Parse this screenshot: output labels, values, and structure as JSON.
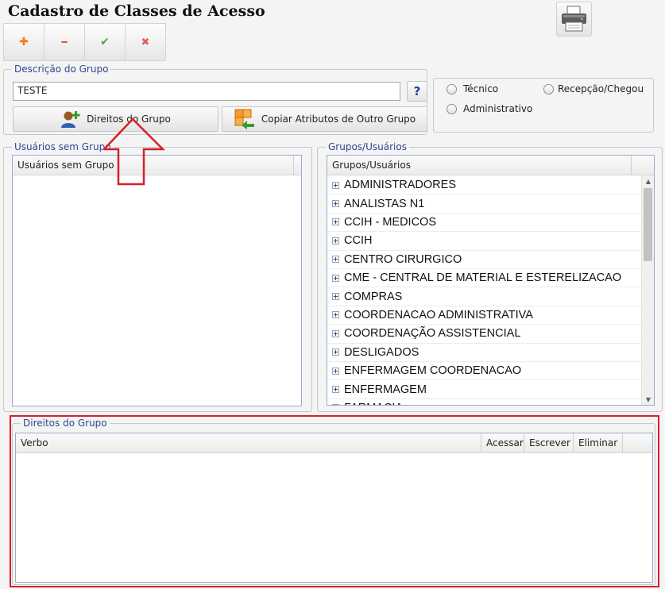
{
  "header": {
    "title": "Cadastro de Classes de Acesso"
  },
  "toolbar": {
    "add_icon": "plus-icon",
    "remove_icon": "minus-icon",
    "confirm_icon": "check-icon",
    "cancel_icon": "x-icon",
    "add_glyph": "✚",
    "remove_glyph": "━",
    "confirm_glyph": "✔",
    "cancel_glyph": "✖",
    "print_icon": "printer-icon"
  },
  "group_description": {
    "legend": "Descrição do Grupo",
    "value": "TESTE",
    "help_label": "?",
    "rights_button_label": "Direitos do Grupo",
    "copy_button_label": "Copiar Atributos de Outro Grupo"
  },
  "user_type": {
    "options": [
      "Técnico",
      "Recepção/Chegou",
      "Administrativo"
    ]
  },
  "users_without_group": {
    "legend": "Usuários sem Grupo",
    "column_header": "Usuários sem Grupo",
    "rows": []
  },
  "groups_users": {
    "legend": "Grupos/Usuários",
    "column_header": "Grupos/Usuários",
    "items": [
      "ADMINISTRADORES",
      "ANALISTAS N1",
      "CCIH - MEDICOS",
      "CCIH",
      "CENTRO CIRURGICO",
      "CME - CENTRAL DE MATERIAL E ESTERELIZACAO",
      "COMPRAS",
      "COORDENACAO ADMINISTRATIVA",
      "COORDENAÇÃO ASSISTENCIAL",
      "DESLIGADOS",
      "ENFERMAGEM COORDENACAO",
      "ENFERMAGEM",
      "FARMACIA"
    ]
  },
  "group_rights": {
    "legend": "Direitos do Grupo",
    "columns": [
      "Verbo",
      "Acessar",
      "Escrever",
      "Eliminar"
    ],
    "rows": []
  },
  "colors": {
    "legend_text": "#31468f",
    "highlight_red": "#d6202a",
    "add_orange": "#f07a16",
    "confirm_green": "#5aa832",
    "cancel_red": "#e06060"
  }
}
